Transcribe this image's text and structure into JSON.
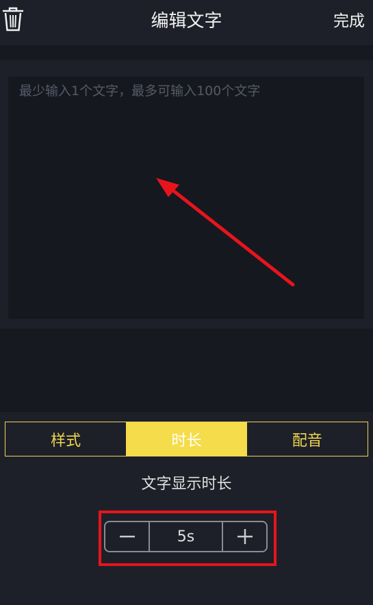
{
  "header": {
    "title": "编辑文字",
    "done_label": "完成",
    "trash_icon": "trash-icon"
  },
  "editor": {
    "placeholder": "最少输入1个文字，最多可输入100个文字",
    "value": ""
  },
  "tabs": [
    {
      "label": "样式",
      "active": false
    },
    {
      "label": "时长",
      "active": true
    },
    {
      "label": "配音",
      "active": false
    }
  ],
  "duration": {
    "label": "文字显示时长",
    "value": "5s",
    "minus_icon": "minus-icon",
    "plus_icon": "plus-icon"
  },
  "colors": {
    "accent": "#f5dc4a",
    "annotation": "#e8141c",
    "background": "#1e2029"
  }
}
